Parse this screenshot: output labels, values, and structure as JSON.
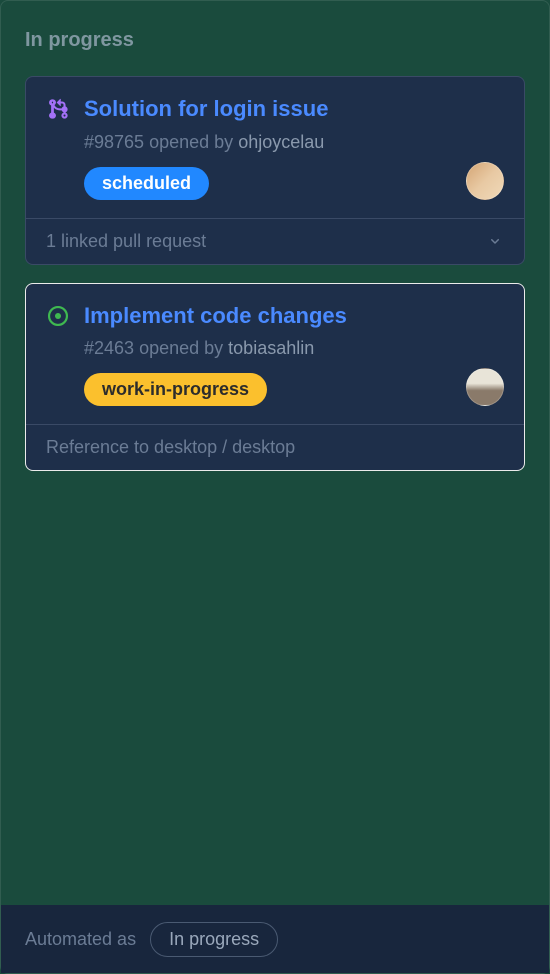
{
  "column": {
    "title": "In progress"
  },
  "cards": [
    {
      "title": "Solution for login issue",
      "issue_number": "#98765",
      "opened_by_text": "opened by",
      "author": "ohjoycelau",
      "label": "scheduled",
      "footer_text": "1 linked pull request",
      "icon": "pull-request"
    },
    {
      "title": "Implement code changes",
      "issue_number": "#2463",
      "opened_by_text": "opened by",
      "author": "tobiasahlin",
      "label": "work-in-progress",
      "footer_text": "Reference to desktop / desktop",
      "icon": "issue-open"
    }
  ],
  "footer": {
    "automated_text": "Automated as",
    "status": "In progress"
  }
}
